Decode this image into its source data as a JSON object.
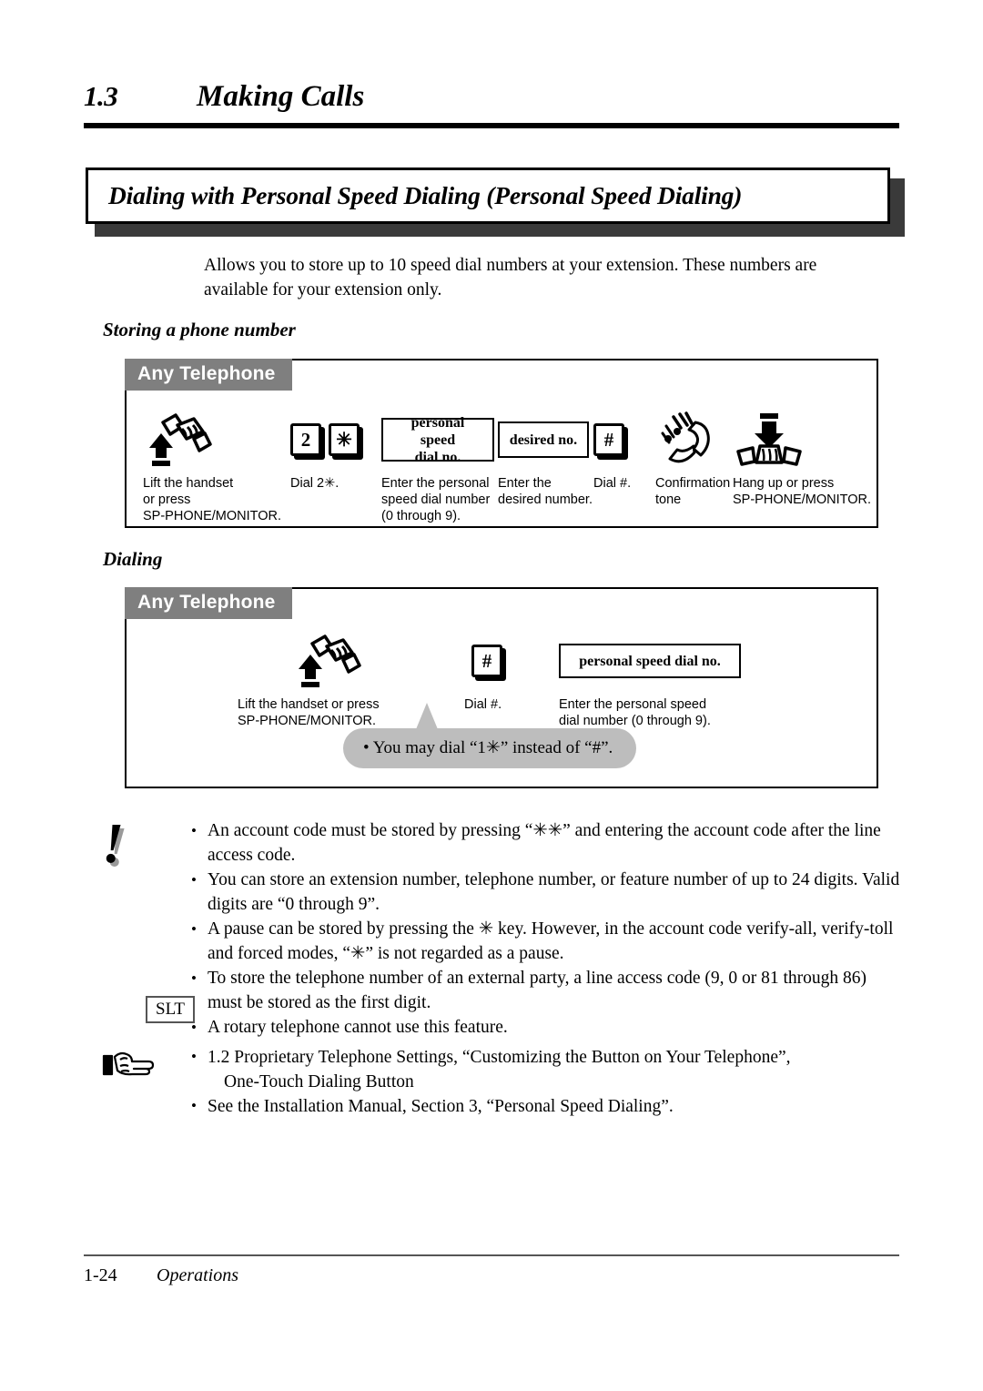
{
  "header": {
    "section_number": "1.3",
    "section_title": "Making Calls",
    "feature_title": "Dialing with Personal Speed Dialing (Personal Speed Dialing)"
  },
  "intro": "Allows you to store up to 10 speed dial numbers at your extension. These numbers are available for your extension only.",
  "sections": {
    "storing": {
      "subhead": "Storing a phone number",
      "badge": "Any Telephone",
      "steps": [
        {
          "art": "lift-handset-icon",
          "label": "Lift the handset\nor press\nSP-PHONE/MONITOR."
        },
        {
          "art": "keycaps",
          "keys": [
            "2",
            "✳"
          ],
          "label": "Dial 2✳."
        },
        {
          "art": "textbox",
          "box_text": "personal speed\ndial no.",
          "label": "Enter the personal\nspeed dial number\n(0 through 9)."
        },
        {
          "art": "textbox",
          "box_text": "desired no.",
          "label": "Enter the\ndesired number."
        },
        {
          "art": "keycaps",
          "keys": [
            "#"
          ],
          "label": "Dial #."
        },
        {
          "art": "ringing-handset-icon",
          "label": "Confirmation\ntone"
        },
        {
          "art": "hang-up-icon",
          "label": "Hang up or press\nSP-PHONE/MONITOR."
        }
      ]
    },
    "dialing": {
      "subhead": "Dialing",
      "badge": "Any Telephone",
      "steps": [
        {
          "art": "lift-handset-icon",
          "label": "Lift the handset or press\nSP-PHONE/MONITOR."
        },
        {
          "art": "keycaps",
          "keys": [
            "#"
          ],
          "label": "Dial #."
        },
        {
          "art": "textbox",
          "box_text": "personal speed dial no.",
          "label": "Enter the personal speed\ndial number (0 through 9)."
        }
      ],
      "bubble": "•  You may dial “1✳” instead of “#”."
    }
  },
  "notes": {
    "icon": "exclamation-icon",
    "items": [
      "An account code must be stored by pressing “✳✳” and entering the account code after the line access code.",
      "You can store an extension number, telephone number, or feature number of up to 24 digits. Valid digits are “0 through 9”.",
      "A pause can be stored by pressing the ✳ key. However, in the account code verify-all, verify-toll and forced modes, “✳” is not regarded as a pause.",
      "To store the telephone number of an external party, a line access code (9, 0 or 81 through 86) must be stored as the first digit.",
      "A rotary telephone cannot use this feature."
    ],
    "slt_badge": "SLT"
  },
  "references": {
    "icon": "pointing-hand-icon",
    "items": [
      "1.2 Proprietary Telephone Settings, “Customizing the Button on Your Telephone”,",
      "See the Installation Manual, Section 3, “Personal Speed Dialing”."
    ],
    "continuation": "One-Touch Dialing Button"
  },
  "footer": {
    "page_number": "1-24",
    "section_name": "Operations"
  },
  "colors": {
    "badge_gray": "#7f7f7f",
    "bubble_gray": "#bdbdbd",
    "title_shadow": "#3a3a3a",
    "rule_black": "#000000"
  }
}
